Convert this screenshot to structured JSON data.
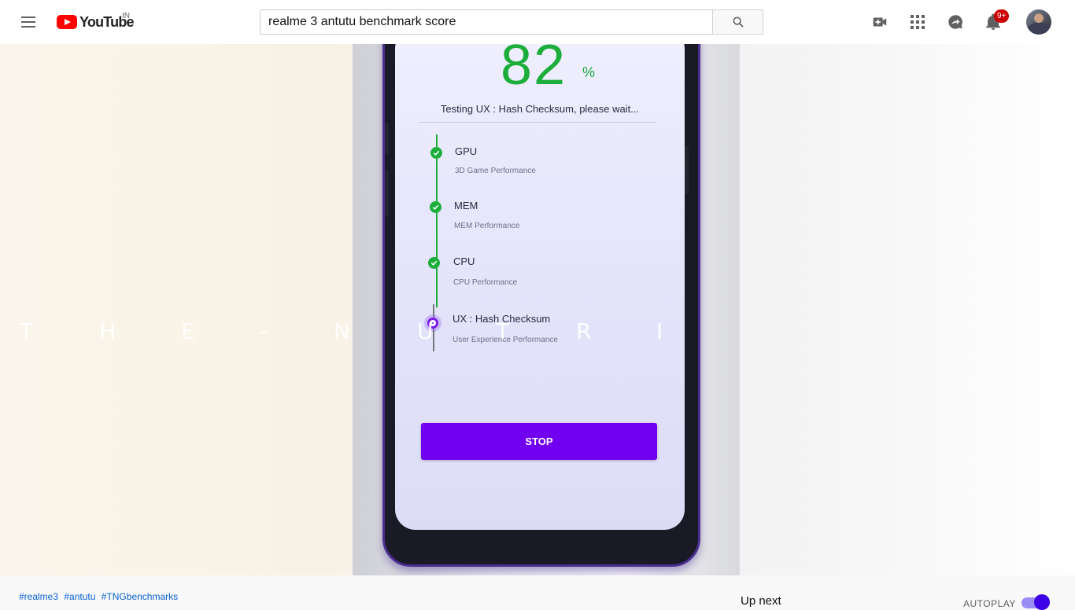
{
  "masthead": {
    "logo_text": "YouTube",
    "country_code": "IN",
    "search_query": "realme 3 antutu benchmark score",
    "notification_count": "9+"
  },
  "video": {
    "benchmark": {
      "score": "82",
      "percent_sign": "%",
      "status": "Testing UX : Hash Checksum, please wait...",
      "steps": [
        {
          "name": "GPU",
          "desc": "3D Game Performance",
          "state": "done"
        },
        {
          "name": "MEM",
          "desc": "MEM Performance",
          "state": "done"
        },
        {
          "name": "CPU",
          "desc": "CPU Performance",
          "state": "done"
        },
        {
          "name": "UX : Hash Checksum",
          "desc": "User Experience Performance",
          "state": "active"
        }
      ],
      "stop_label": "STOP"
    },
    "overlay_letters": [
      "T",
      "H",
      "E",
      "-",
      "N",
      "U",
      "T",
      "R",
      "I"
    ]
  },
  "below": {
    "hashtags": [
      "#realme3",
      "#antutu",
      "#TNGbenchmarks"
    ],
    "up_next": "Up next",
    "autoplay": "AUTOPLAY"
  },
  "colors": {
    "accent_green": "#1cad3b",
    "stop_purple": "#7000ef",
    "youtube_red": "#ff0000",
    "badge_red": "#cc0000",
    "link_blue": "#065fd4"
  }
}
